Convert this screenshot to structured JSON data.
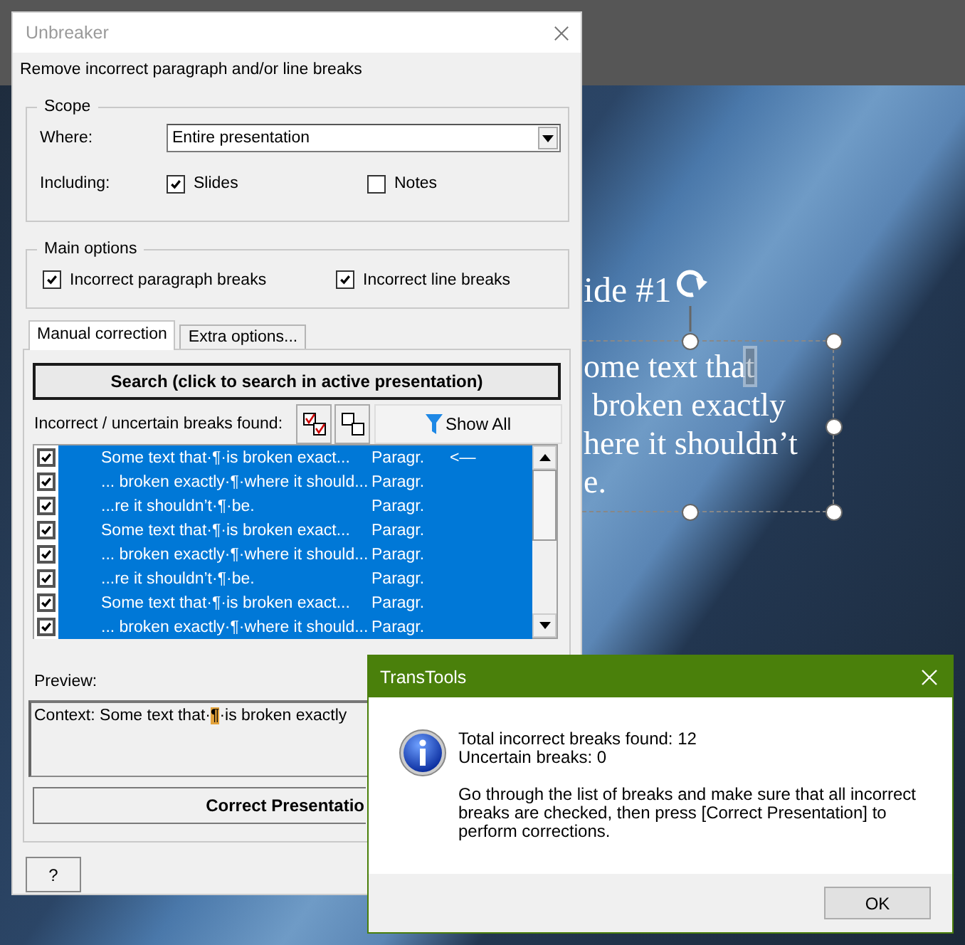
{
  "slide": {
    "title": "ide #1",
    "body_lines": [
      "ome text that",
      "broken exactly",
      "here it shouldn’t",
      "e."
    ]
  },
  "unbreaker": {
    "title": "Unbreaker",
    "subtitle": "Remove incorrect paragraph and/or line breaks",
    "scope": {
      "legend": "Scope",
      "where_label": "Where:",
      "where_value": "Entire presentation",
      "including_label": "Including:",
      "options": [
        {
          "label": "Slides",
          "checked": true
        },
        {
          "label": "Notes",
          "checked": false
        }
      ]
    },
    "main_options": {
      "legend": "Main options",
      "options": [
        {
          "label": "Incorrect paragraph breaks",
          "checked": true
        },
        {
          "label": "Incorrect line breaks",
          "checked": true
        }
      ]
    },
    "tabs": [
      {
        "label": "Manual correction",
        "selected": true
      },
      {
        "label": "Extra options...",
        "selected": false
      }
    ],
    "search_button": "Search (click to search in active presentation)",
    "found_label": "Incorrect / uncertain breaks found:",
    "show_all_button": "Show All",
    "breaks": [
      {
        "text": "Some text that·¶·is broken exact...",
        "type": "Paragr.",
        "flag": "<—",
        "checked": true,
        "selected": true
      },
      {
        "text": "... broken exactly·¶·where it should...",
        "type": "Paragr.",
        "checked": true,
        "selected": true
      },
      {
        "text": "...re it shouldn’t·¶·be.",
        "type": "Paragr.",
        "checked": true,
        "selected": true
      },
      {
        "text": "Some text that·¶·is broken exact...",
        "type": "Paragr.",
        "checked": true,
        "selected": true
      },
      {
        "text": "... broken exactly·¶·where it should...",
        "type": "Paragr.",
        "checked": true,
        "selected": true
      },
      {
        "text": "...re it shouldn’t·¶·be.",
        "type": "Paragr.",
        "checked": true,
        "selected": true
      },
      {
        "text": "Some text that·¶·is broken exact...",
        "type": "Paragr.",
        "checked": true,
        "selected": true
      },
      {
        "text": "... broken exactly·¶·where it should...",
        "type": "Paragr.",
        "checked": true,
        "selected": true
      }
    ],
    "preview_label": "Preview:",
    "preview": {
      "before": "Context: Some text that·",
      "mark": "¶",
      "after": "·is broken exactly"
    },
    "correct_button": "Correct Presentatio",
    "help_button": "?"
  },
  "message_box": {
    "title": "TransTools",
    "lines": [
      "Total incorrect breaks found: 12",
      "Uncertain breaks: 0"
    ],
    "message": "Go through the list of breaks and make sure that all incorrect breaks are checked, then press [Correct Presentation] to perform corrections.",
    "ok_button": "OK"
  }
}
